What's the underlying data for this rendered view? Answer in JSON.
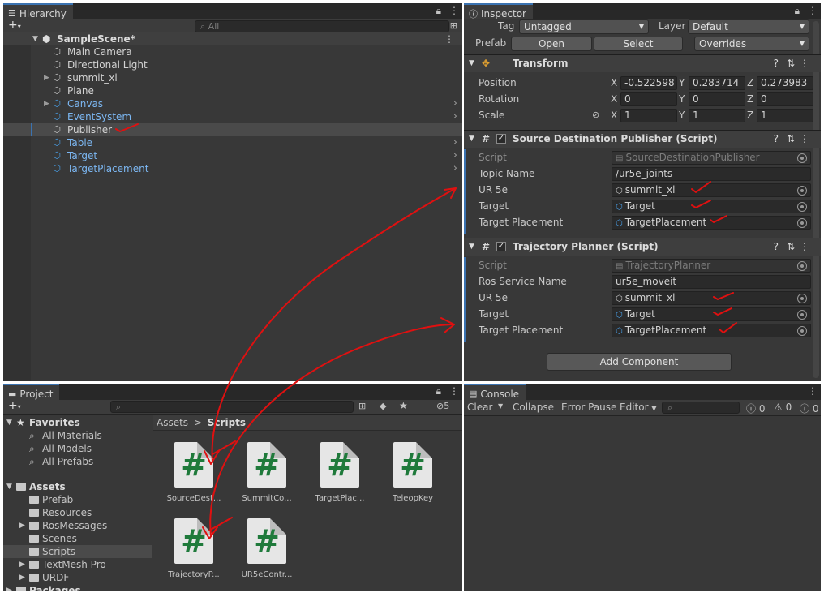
{
  "hierarchy": {
    "tab": "Hierarchy",
    "search_placeholder": "All",
    "scene": "SampleScene*",
    "items": [
      {
        "label": "Main Camera",
        "color": "white",
        "expand": false
      },
      {
        "label": "Directional Light",
        "color": "white",
        "expand": false
      },
      {
        "label": "summit_xl",
        "color": "white",
        "expand": true
      },
      {
        "label": "Plane",
        "color": "white",
        "expand": false
      },
      {
        "label": "Canvas",
        "color": "blue",
        "expand": true
      },
      {
        "label": "EventSystem",
        "color": "blue",
        "expand": false
      },
      {
        "label": "Publisher",
        "color": "white",
        "expand": false
      },
      {
        "label": "Table",
        "color": "blue",
        "expand": false
      },
      {
        "label": "Target",
        "color": "blue",
        "expand": false
      },
      {
        "label": "TargetPlacement",
        "color": "blue",
        "expand": false
      }
    ]
  },
  "inspector": {
    "tab": "Inspector",
    "tag_label": "Tag",
    "tag_value": "Untagged",
    "layer_label": "Layer",
    "layer_value": "Default",
    "prefab_label": "Prefab",
    "open": "Open",
    "select": "Select",
    "overrides": "Overrides",
    "transform": {
      "title": "Transform",
      "position": "Position",
      "rotation": "Rotation",
      "scale": "Scale",
      "pos": [
        "-0.522598",
        "0.283714",
        "0.273983"
      ],
      "rot": [
        "0",
        "0",
        "0"
      ],
      "scl": [
        "1",
        "1",
        "1"
      ],
      "x": "X",
      "y": "Y",
      "z": "Z"
    },
    "sdp": {
      "title": "Source Destination Publisher (Script)",
      "script_label": "Script",
      "script_value": "SourceDestinationPublisher",
      "topic_label": "Topic Name",
      "topic_value": "/ur5e_joints",
      "ur5e_label": "UR 5e",
      "ur5e_value": "summit_xl",
      "target_label": "Target",
      "target_value": "Target",
      "tp_label": "Target Placement",
      "tp_value": "TargetPlacement"
    },
    "tp": {
      "title": "Trajectory Planner (Script)",
      "script_label": "Script",
      "script_value": "TrajectoryPlanner",
      "ros_label": "Ros Service Name",
      "ros_value": "ur5e_moveit",
      "ur5e_label": "UR 5e",
      "ur5e_value": "summit_xl",
      "target_label": "Target",
      "target_value": "Target",
      "tp_label": "Target Placement",
      "tp_value": "TargetPlacement"
    },
    "add_component": "Add Component"
  },
  "project": {
    "tab": "Project",
    "hidden_count": "5",
    "favorites": "Favorites",
    "fav_items": [
      "All Materials",
      "All Models",
      "All Prefabs"
    ],
    "assets": "Assets",
    "asset_items": [
      "Prefab",
      "Resources",
      "RosMessages",
      "Scenes",
      "Scripts",
      "TextMesh Pro",
      "URDF"
    ],
    "packages": "Packages",
    "breadcrumb_root": "Assets",
    "breadcrumb_sep": ">",
    "breadcrumb_current": "Scripts",
    "files": [
      "SourceDest...",
      "SummitCo...",
      "TargetPlac...",
      "TeleopKey",
      "TrajectoryP...",
      "UR5eContr..."
    ]
  },
  "console": {
    "tab": "Console",
    "clear": "Clear",
    "collapse": "Collapse",
    "error_pause": "Error Pause",
    "editor": "Editor",
    "count_info": "0",
    "count_warn": "0",
    "count_err": "0"
  },
  "colors": {
    "annotation": "#e01010",
    "selection": "#2c5d87",
    "blue_text": "#7cb7f2"
  }
}
